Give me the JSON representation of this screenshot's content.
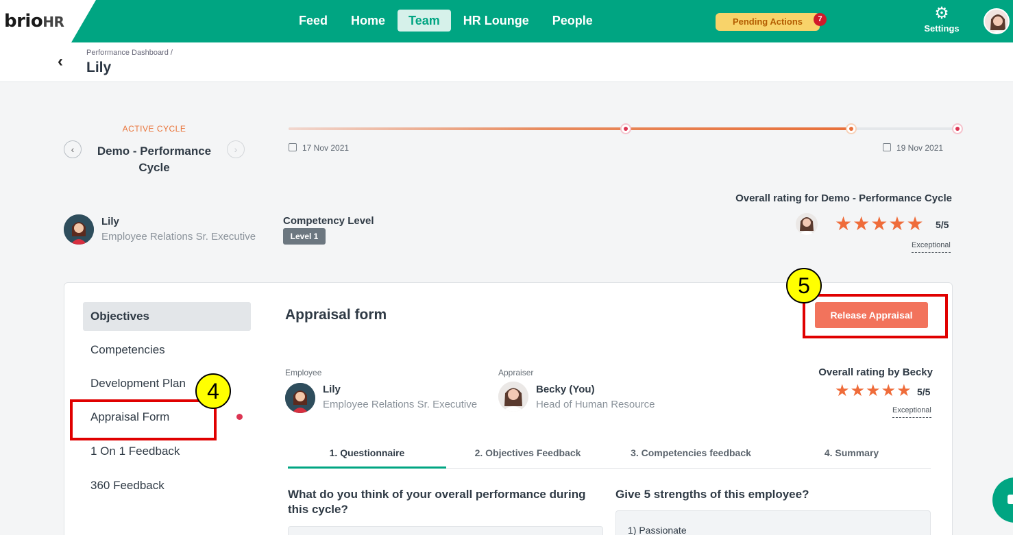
{
  "brand": {
    "name": "brio",
    "suffix": "HR"
  },
  "nav": {
    "items": [
      {
        "label": "Feed",
        "active": false
      },
      {
        "label": "Home",
        "active": false
      },
      {
        "label": "Team",
        "active": true
      },
      {
        "label": "HR Lounge",
        "active": false
      },
      {
        "label": "People",
        "active": false
      }
    ],
    "pending_label": "Pending Actions",
    "pending_count": "7",
    "settings_label": "Settings"
  },
  "header": {
    "breadcrumb": "Performance Dashboard /",
    "title": "Lily"
  },
  "cycle": {
    "label": "ACTIVE CYCLE",
    "name": "Demo - Performance Cycle",
    "start_date": "17 Nov 2021",
    "end_date": "19 Nov 2021",
    "progress_fraction": 0.843
  },
  "employee": {
    "name": "Lily",
    "role": "Employee Relations Sr. Executive",
    "competency_label": "Competency Level",
    "competency_value": "Level 1"
  },
  "overall": {
    "title": "Overall rating for Demo - Performance Cycle",
    "stars": 5,
    "score": "5/5",
    "word": "Exceptional"
  },
  "sidebar": {
    "items": [
      {
        "label": "Objectives",
        "active": true
      },
      {
        "label": "Competencies",
        "active": false
      },
      {
        "label": "Development Plan",
        "active": false
      },
      {
        "label": "Appraisal Form",
        "active": false
      },
      {
        "label": "1 On 1 Feedback",
        "active": false
      },
      {
        "label": "360 Feedback",
        "active": false
      }
    ]
  },
  "form": {
    "title": "Appraisal form",
    "release_label": "Release Appraisal",
    "employee_label": "Employee",
    "employee_name": "Lily",
    "employee_role": "Employee Relations Sr. Executive",
    "appraiser_label": "Appraiser",
    "appraiser_name": "Becky (You)",
    "appraiser_role": "Head of Human Resource",
    "rating_title": "Overall rating by Becky",
    "rating_stars": 5,
    "rating_score": "5/5",
    "rating_word": "Exceptional",
    "tabs": [
      {
        "label": "1. Questionnaire",
        "active": true
      },
      {
        "label": "2. Objectives Feedback",
        "active": false
      },
      {
        "label": "3. Competencies feedback",
        "active": false
      },
      {
        "label": "4. Summary",
        "active": false
      }
    ],
    "question1": "What do you think of your overall performance during this cycle?",
    "question2": "Give 5 strengths of this employee?",
    "answer2_first": "1) Passionate"
  },
  "annotations": {
    "step4": "4",
    "step5": "5"
  },
  "colors": {
    "brand": "#00a582",
    "accent": "#e8703a",
    "release": "#f2735c",
    "highlight": "#e00000",
    "callout": "#ffff00"
  }
}
